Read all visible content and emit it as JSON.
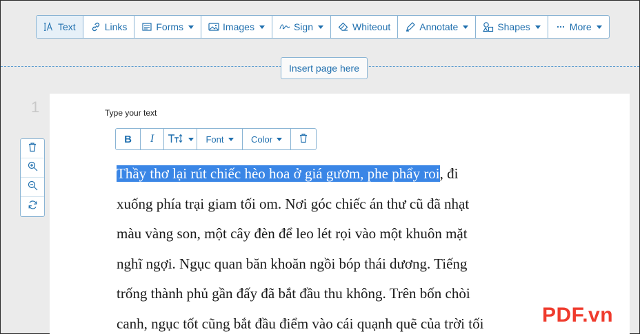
{
  "toolbar": {
    "items": [
      {
        "label": "Text",
        "icon": "text-cursor-icon",
        "active": true,
        "dropdown": false
      },
      {
        "label": "Links",
        "icon": "link-icon",
        "dropdown": false
      },
      {
        "label": "Forms",
        "icon": "form-icon",
        "dropdown": true
      },
      {
        "label": "Images",
        "icon": "image-icon",
        "dropdown": true
      },
      {
        "label": "Sign",
        "icon": "signature-icon",
        "dropdown": true
      },
      {
        "label": "Whiteout",
        "icon": "eraser-icon",
        "dropdown": false
      },
      {
        "label": "Annotate",
        "icon": "pen-icon",
        "dropdown": true
      },
      {
        "label": "Shapes",
        "icon": "shapes-icon",
        "dropdown": true
      },
      {
        "label": "More",
        "icon": "ellipsis-icon",
        "dropdown": true
      }
    ]
  },
  "insert_page_label": "Insert page here",
  "page_number": "1",
  "type_hint": "Type your text",
  "format_bar": {
    "bold": "B",
    "italic": "I",
    "size_icon": "text-size-icon",
    "font_label": "Font",
    "color_label": "Color",
    "delete_icon": "trash-icon"
  },
  "side_tools": [
    "trash-icon",
    "zoom-in-icon",
    "zoom-out-icon",
    "rotate-icon"
  ],
  "text": {
    "highlighted": "Thầy thơ lại rút chiếc hèo hoa ở giá gươm, phe phẩy roi",
    "line1_rest": ", đi",
    "lines": [
      "xuống phía trại giam tối om. Nơi góc chiếc án thư cũ đã nhạt",
      "màu vàng son, một cây đèn để leo lét rọi vào một khuôn mặt",
      "nghĩ ngợi. Ngục quan băn khoăn ngồi bóp thái dương. Tiếng",
      "trống thành phủ gần đấy đã bắt đầu thu không. Trên bốn chòi",
      "canh, ngục tốt cũng bắt đầu điểm vào cái quạnh quẽ của trời tối"
    ]
  },
  "watermark": {
    "brand": "PDF",
    "suffix": ".vn"
  },
  "colors": {
    "accent": "#1f6fae",
    "highlight": "#3a86e6",
    "border": "#8ab4d4",
    "watermark": "#ef3b2d"
  }
}
